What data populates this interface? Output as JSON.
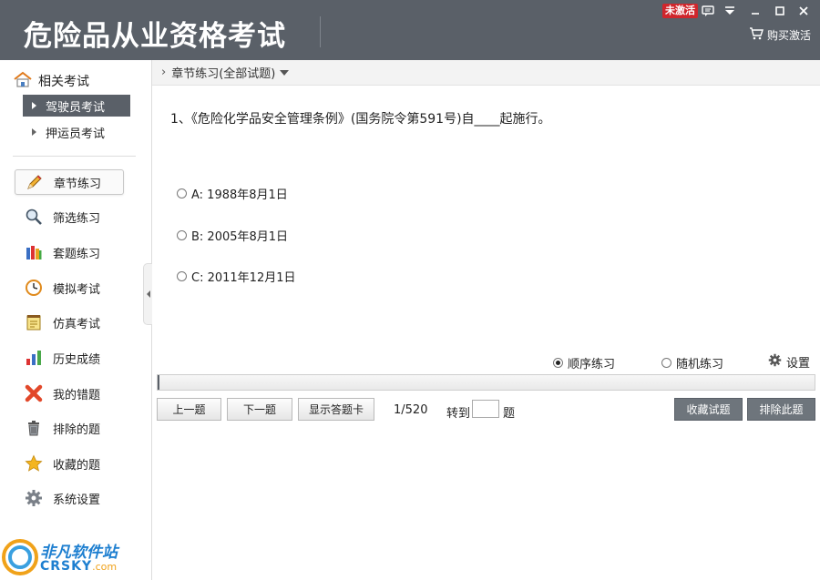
{
  "header": {
    "title": "危险品从业资格考试",
    "badge": "未激活",
    "buy_label": "购买激活"
  },
  "sidebar": {
    "related_title": "相关考试",
    "related_items": [
      {
        "label": "驾驶员考试",
        "active": true
      },
      {
        "label": "押运员考试",
        "active": false
      }
    ],
    "nav": [
      {
        "label": "章节练习",
        "icon": "pencil-icon"
      },
      {
        "label": "筛选练习",
        "icon": "magnifier-icon"
      },
      {
        "label": "套题练习",
        "icon": "books-icon"
      },
      {
        "label": "模拟考试",
        "icon": "clock-icon"
      },
      {
        "label": "仿真考试",
        "icon": "notepad-icon"
      },
      {
        "label": "历史成绩",
        "icon": "bar-chart-icon"
      },
      {
        "label": "我的错题",
        "icon": "red-x-icon"
      },
      {
        "label": "排除的题",
        "icon": "trash-icon"
      },
      {
        "label": "收藏的题",
        "icon": "star-icon"
      },
      {
        "label": "系统设置",
        "icon": "gear-icon"
      }
    ],
    "watermark": {
      "top": "非凡软件站",
      "bottom": "CRSKY",
      "suffix": ".com"
    }
  },
  "main": {
    "breadcrumb": "章节练习(全部试题)",
    "question": "1、《危险化学品安全管理条例》(国务院令第591号)自____起施行。",
    "options": [
      {
        "label": "A: 1988年8月1日"
      },
      {
        "label": "B: 2005年8月1日"
      },
      {
        "label": "C: 2011年12月1日"
      }
    ],
    "modes": {
      "sequential": "顺序练习",
      "random": "随机练习",
      "settings": "设置"
    },
    "progress_fraction": 0.0028,
    "buttons": {
      "prev": "上一题",
      "next": "下一题",
      "show_card": "显示答题卡",
      "collect": "收藏试题",
      "exclude": "排除此题"
    },
    "counter": "1/520",
    "goto_label": "转到",
    "goto_value": "",
    "goto_unit": "题"
  },
  "colors": {
    "header_bg": "#5a6068",
    "badge_red": "#d0262c"
  }
}
